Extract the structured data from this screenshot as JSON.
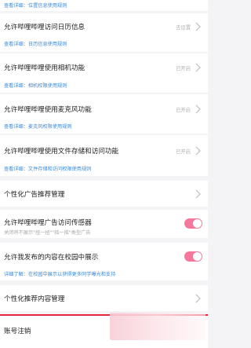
{
  "rows": [
    {
      "sub": "查看详细：位置信息使用规则"
    },
    {
      "title": "允许哔哩哔哩访问日历信息",
      "status": "去设置",
      "sub": "查看详细：日历信息使用规则"
    },
    {
      "title": "允许哔哩哔哩使用相机功能",
      "status": "已开启",
      "sub": "查看详细：相机权限使用规则"
    },
    {
      "title": "允许哔哩哔哩使用麦克风功能",
      "status": "已开启",
      "sub": "查看详细：麦克风权限使用规则"
    },
    {
      "title": "允许哔哩哔哩使用文件存储和访问功能",
      "status": "已开启",
      "sub": "查看详细：文件存储和访问权限使用规则"
    },
    {
      "title": "个性化广告推荐管理"
    },
    {
      "title": "允许哔哩哔哩广告访问传感器",
      "toggle_on": true,
      "sub": "关闭将不展示\"扭一扭\"\"摇一摇\"类型广告"
    },
    {
      "title": "允许我发布的内容在校园中展示",
      "toggle_on": true,
      "sub": "详细了解：在校园中展示以获得更多同学曝光和支持"
    },
    {
      "title": "个性化推荐内容管理"
    }
  ],
  "account": {
    "title": "账号注销"
  },
  "colors": {
    "accent": "#f5789c",
    "link": "#3b8bd9",
    "danger": "#e8273e"
  }
}
